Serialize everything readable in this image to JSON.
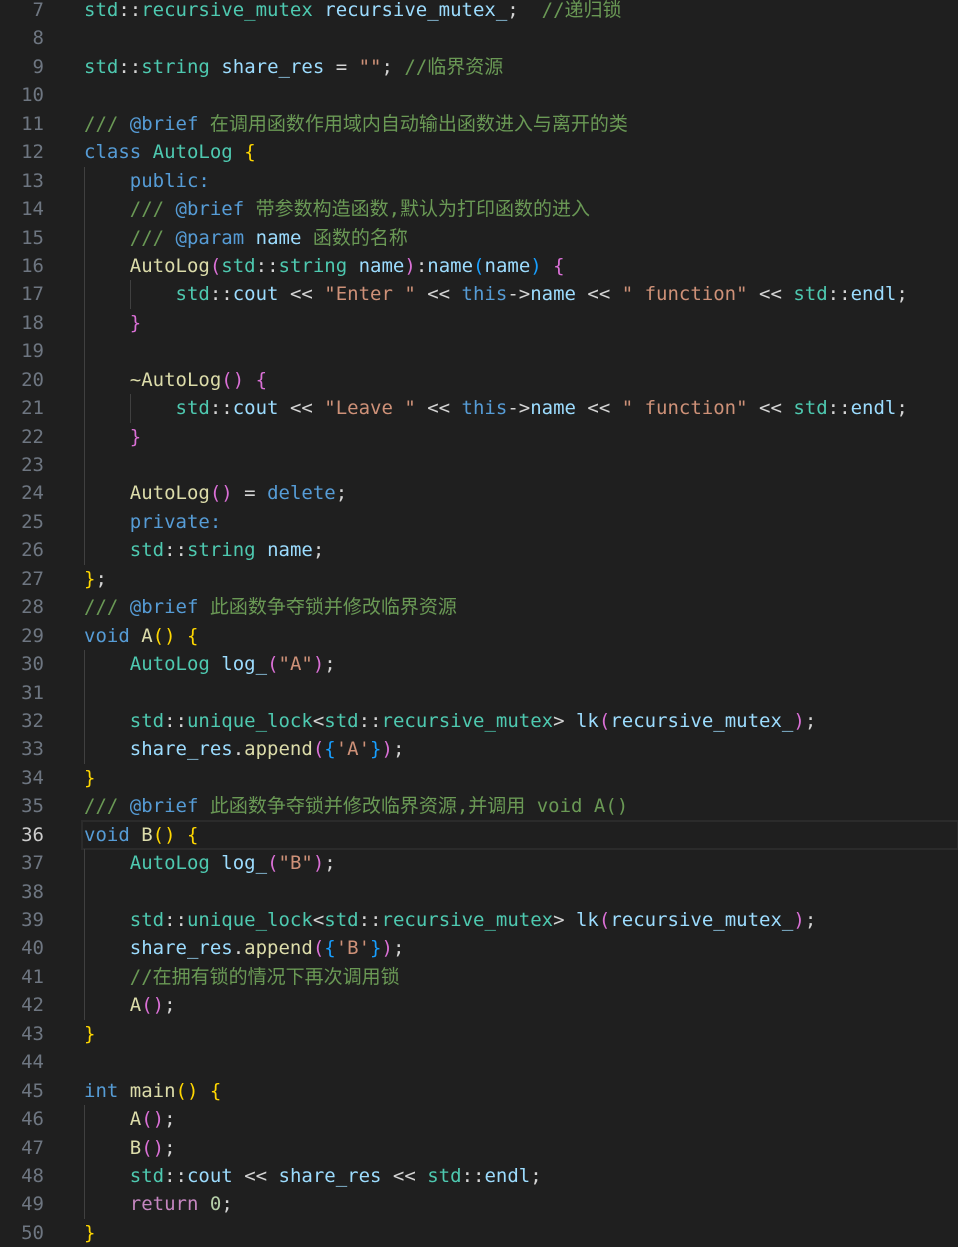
{
  "editor": {
    "current_line": 36,
    "lines": [
      {
        "n": "7",
        "tokens": [
          [
            "type",
            "std"
          ],
          [
            "p",
            "::"
          ],
          [
            "type",
            "recursive_mutex"
          ],
          [
            "p",
            " "
          ],
          [
            "var",
            "recursive_mutex_"
          ],
          [
            "p",
            ";"
          ],
          [
            "p",
            "  "
          ],
          [
            "cm",
            "//递归锁"
          ]
        ]
      },
      {
        "n": "8",
        "tokens": []
      },
      {
        "n": "9",
        "tokens": [
          [
            "type",
            "std"
          ],
          [
            "p",
            "::"
          ],
          [
            "type",
            "string"
          ],
          [
            "p",
            " "
          ],
          [
            "var",
            "share_res"
          ],
          [
            "p",
            " = "
          ],
          [
            "str",
            "\"\""
          ],
          [
            "p",
            "; "
          ],
          [
            "cm",
            "//临界资源"
          ]
        ]
      },
      {
        "n": "10",
        "tokens": []
      },
      {
        "n": "11",
        "tokens": [
          [
            "cm",
            "/// "
          ],
          [
            "kw",
            "@brief"
          ],
          [
            "cm",
            " 在调用函数作用域内自动输出函数进入与离开的类"
          ]
        ]
      },
      {
        "n": "12",
        "tokens": [
          [
            "kw",
            "class"
          ],
          [
            "p",
            " "
          ],
          [
            "type",
            "AutoLog"
          ],
          [
            "p",
            " "
          ],
          [
            "b1",
            "{"
          ]
        ]
      },
      {
        "n": "13",
        "tokens": [
          [
            "p",
            "    "
          ],
          [
            "kw",
            "public:"
          ]
        ]
      },
      {
        "n": "14",
        "tokens": [
          [
            "p",
            "    "
          ],
          [
            "cm",
            "/// "
          ],
          [
            "kw",
            "@brief"
          ],
          [
            "cm",
            " 带参数构造函数,默认为打印函数的进入"
          ]
        ]
      },
      {
        "n": "15",
        "tokens": [
          [
            "p",
            "    "
          ],
          [
            "cm",
            "/// "
          ],
          [
            "kw",
            "@param"
          ],
          [
            "cm",
            " "
          ],
          [
            "var",
            "name"
          ],
          [
            "cm",
            " 函数的名称"
          ]
        ]
      },
      {
        "n": "16",
        "tokens": [
          [
            "p",
            "    "
          ],
          [
            "fn",
            "AutoLog"
          ],
          [
            "b2",
            "("
          ],
          [
            "type",
            "std"
          ],
          [
            "p",
            "::"
          ],
          [
            "type",
            "string"
          ],
          [
            "p",
            " "
          ],
          [
            "var",
            "name"
          ],
          [
            "b2",
            ")"
          ],
          [
            "p",
            ":"
          ],
          [
            "var",
            "name"
          ],
          [
            "b3",
            "("
          ],
          [
            "var",
            "name"
          ],
          [
            "b3",
            ")"
          ],
          [
            "p",
            " "
          ],
          [
            "b2",
            "{"
          ]
        ]
      },
      {
        "n": "17",
        "tokens": [
          [
            "p",
            "        "
          ],
          [
            "type",
            "std"
          ],
          [
            "p",
            "::"
          ],
          [
            "var",
            "cout"
          ],
          [
            "p",
            " << "
          ],
          [
            "str",
            "\"Enter \""
          ],
          [
            "p",
            " << "
          ],
          [
            "kw",
            "this"
          ],
          [
            "p",
            "->"
          ],
          [
            "var",
            "name"
          ],
          [
            "p",
            " << "
          ],
          [
            "str",
            "\" function\""
          ],
          [
            "p",
            " << "
          ],
          [
            "type",
            "std"
          ],
          [
            "p",
            "::"
          ],
          [
            "var",
            "endl"
          ],
          [
            "p",
            ";"
          ]
        ]
      },
      {
        "n": "18",
        "tokens": [
          [
            "p",
            "    "
          ],
          [
            "b2",
            "}"
          ]
        ]
      },
      {
        "n": "19",
        "tokens": []
      },
      {
        "n": "20",
        "tokens": [
          [
            "p",
            "    "
          ],
          [
            "fn",
            "~AutoLog"
          ],
          [
            "b2",
            "()"
          ],
          [
            "p",
            " "
          ],
          [
            "b2",
            "{"
          ]
        ]
      },
      {
        "n": "21",
        "tokens": [
          [
            "p",
            "        "
          ],
          [
            "type",
            "std"
          ],
          [
            "p",
            "::"
          ],
          [
            "var",
            "cout"
          ],
          [
            "p",
            " << "
          ],
          [
            "str",
            "\"Leave \""
          ],
          [
            "p",
            " << "
          ],
          [
            "kw",
            "this"
          ],
          [
            "p",
            "->"
          ],
          [
            "var",
            "name"
          ],
          [
            "p",
            " << "
          ],
          [
            "str",
            "\" function\""
          ],
          [
            "p",
            " << "
          ],
          [
            "type",
            "std"
          ],
          [
            "p",
            "::"
          ],
          [
            "var",
            "endl"
          ],
          [
            "p",
            ";"
          ]
        ]
      },
      {
        "n": "22",
        "tokens": [
          [
            "p",
            "    "
          ],
          [
            "b2",
            "}"
          ]
        ]
      },
      {
        "n": "23",
        "tokens": []
      },
      {
        "n": "24",
        "tokens": [
          [
            "p",
            "    "
          ],
          [
            "fn",
            "AutoLog"
          ],
          [
            "b2",
            "()"
          ],
          [
            "p",
            " = "
          ],
          [
            "kw",
            "delete"
          ],
          [
            "p",
            ";"
          ]
        ]
      },
      {
        "n": "25",
        "tokens": [
          [
            "p",
            "    "
          ],
          [
            "kw",
            "private:"
          ]
        ]
      },
      {
        "n": "26",
        "tokens": [
          [
            "p",
            "    "
          ],
          [
            "type",
            "std"
          ],
          [
            "p",
            "::"
          ],
          [
            "type",
            "string"
          ],
          [
            "p",
            " "
          ],
          [
            "var",
            "name"
          ],
          [
            "p",
            ";"
          ]
        ]
      },
      {
        "n": "27",
        "tokens": [
          [
            "b1",
            "}"
          ],
          [
            "p",
            ";"
          ]
        ]
      },
      {
        "n": "28",
        "tokens": [
          [
            "cm",
            "/// "
          ],
          [
            "kw",
            "@brief"
          ],
          [
            "cm",
            " 此函数争夺锁并修改临界资源"
          ]
        ]
      },
      {
        "n": "29",
        "tokens": [
          [
            "kw",
            "void"
          ],
          [
            "p",
            " "
          ],
          [
            "fn",
            "A"
          ],
          [
            "b1",
            "()"
          ],
          [
            "p",
            " "
          ],
          [
            "b1",
            "{"
          ]
        ]
      },
      {
        "n": "30",
        "tokens": [
          [
            "p",
            "    "
          ],
          [
            "type",
            "AutoLog"
          ],
          [
            "p",
            " "
          ],
          [
            "var",
            "log_"
          ],
          [
            "b2",
            "("
          ],
          [
            "str",
            "\"A\""
          ],
          [
            "b2",
            ")"
          ],
          [
            "p",
            ";"
          ]
        ]
      },
      {
        "n": "31",
        "tokens": []
      },
      {
        "n": "32",
        "tokens": [
          [
            "p",
            "    "
          ],
          [
            "type",
            "std"
          ],
          [
            "p",
            "::"
          ],
          [
            "type",
            "unique_lock"
          ],
          [
            "p",
            "<"
          ],
          [
            "type",
            "std"
          ],
          [
            "p",
            "::"
          ],
          [
            "type",
            "recursive_mutex"
          ],
          [
            "p",
            "> "
          ],
          [
            "var",
            "lk"
          ],
          [
            "b2",
            "("
          ],
          [
            "var",
            "recursive_mutex_"
          ],
          [
            "b2",
            ")"
          ],
          [
            "p",
            ";"
          ]
        ]
      },
      {
        "n": "33",
        "tokens": [
          [
            "p",
            "    "
          ],
          [
            "var",
            "share_res"
          ],
          [
            "p",
            "."
          ],
          [
            "fn",
            "append"
          ],
          [
            "b2",
            "("
          ],
          [
            "b3",
            "{"
          ],
          [
            "str",
            "'A'"
          ],
          [
            "b3",
            "}"
          ],
          [
            "b2",
            ")"
          ],
          [
            "p",
            ";"
          ]
        ]
      },
      {
        "n": "34",
        "tokens": [
          [
            "b1",
            "}"
          ]
        ]
      },
      {
        "n": "35",
        "tokens": [
          [
            "cm",
            "/// "
          ],
          [
            "kw",
            "@brief"
          ],
          [
            "cm",
            " 此函数争夺锁并修改临界资源,并调用 void A()"
          ]
        ]
      },
      {
        "n": "36",
        "tokens": [
          [
            "kw",
            "void"
          ],
          [
            "p",
            " "
          ],
          [
            "fn",
            "B"
          ],
          [
            "b1",
            "()"
          ],
          [
            "p",
            " "
          ],
          [
            "b1",
            "{"
          ]
        ]
      },
      {
        "n": "37",
        "tokens": [
          [
            "p",
            "    "
          ],
          [
            "type",
            "AutoLog"
          ],
          [
            "p",
            " "
          ],
          [
            "var",
            "log_"
          ],
          [
            "b2",
            "("
          ],
          [
            "str",
            "\"B\""
          ],
          [
            "b2",
            ")"
          ],
          [
            "p",
            ";"
          ]
        ]
      },
      {
        "n": "38",
        "tokens": []
      },
      {
        "n": "39",
        "tokens": [
          [
            "p",
            "    "
          ],
          [
            "type",
            "std"
          ],
          [
            "p",
            "::"
          ],
          [
            "type",
            "unique_lock"
          ],
          [
            "p",
            "<"
          ],
          [
            "type",
            "std"
          ],
          [
            "p",
            "::"
          ],
          [
            "type",
            "recursive_mutex"
          ],
          [
            "p",
            "> "
          ],
          [
            "var",
            "lk"
          ],
          [
            "b2",
            "("
          ],
          [
            "var",
            "recursive_mutex_"
          ],
          [
            "b2",
            ")"
          ],
          [
            "p",
            ";"
          ]
        ]
      },
      {
        "n": "40",
        "tokens": [
          [
            "p",
            "    "
          ],
          [
            "var",
            "share_res"
          ],
          [
            "p",
            "."
          ],
          [
            "fn",
            "append"
          ],
          [
            "b2",
            "("
          ],
          [
            "b3",
            "{"
          ],
          [
            "str",
            "'B'"
          ],
          [
            "b3",
            "}"
          ],
          [
            "b2",
            ")"
          ],
          [
            "p",
            ";"
          ]
        ]
      },
      {
        "n": "41",
        "tokens": [
          [
            "p",
            "    "
          ],
          [
            "cm",
            "//在拥有锁的情况下再次调用锁"
          ]
        ]
      },
      {
        "n": "42",
        "tokens": [
          [
            "p",
            "    "
          ],
          [
            "fn",
            "A"
          ],
          [
            "b2",
            "()"
          ],
          [
            "p",
            ";"
          ]
        ]
      },
      {
        "n": "43",
        "tokens": [
          [
            "b1",
            "}"
          ]
        ]
      },
      {
        "n": "44",
        "tokens": []
      },
      {
        "n": "45",
        "tokens": [
          [
            "kw",
            "int"
          ],
          [
            "p",
            " "
          ],
          [
            "fn",
            "main"
          ],
          [
            "b1",
            "()"
          ],
          [
            "p",
            " "
          ],
          [
            "b1",
            "{"
          ]
        ]
      },
      {
        "n": "46",
        "tokens": [
          [
            "p",
            "    "
          ],
          [
            "fn",
            "A"
          ],
          [
            "b2",
            "()"
          ],
          [
            "p",
            ";"
          ]
        ]
      },
      {
        "n": "47",
        "tokens": [
          [
            "p",
            "    "
          ],
          [
            "fn",
            "B"
          ],
          [
            "b2",
            "()"
          ],
          [
            "p",
            ";"
          ]
        ]
      },
      {
        "n": "48",
        "tokens": [
          [
            "p",
            "    "
          ],
          [
            "type",
            "std"
          ],
          [
            "p",
            "::"
          ],
          [
            "var",
            "cout"
          ],
          [
            "p",
            " << "
          ],
          [
            "var",
            "share_res"
          ],
          [
            "p",
            " << "
          ],
          [
            "type",
            "std"
          ],
          [
            "p",
            "::"
          ],
          [
            "var",
            "endl"
          ],
          [
            "p",
            ";"
          ]
        ]
      },
      {
        "n": "49",
        "tokens": [
          [
            "p",
            "    "
          ],
          [
            "ctl",
            "return"
          ],
          [
            "p",
            " "
          ],
          [
            "num",
            "0"
          ],
          [
            "p",
            ";"
          ]
        ]
      },
      {
        "n": "50",
        "tokens": [
          [
            "b1",
            "}"
          ]
        ]
      }
    ]
  }
}
